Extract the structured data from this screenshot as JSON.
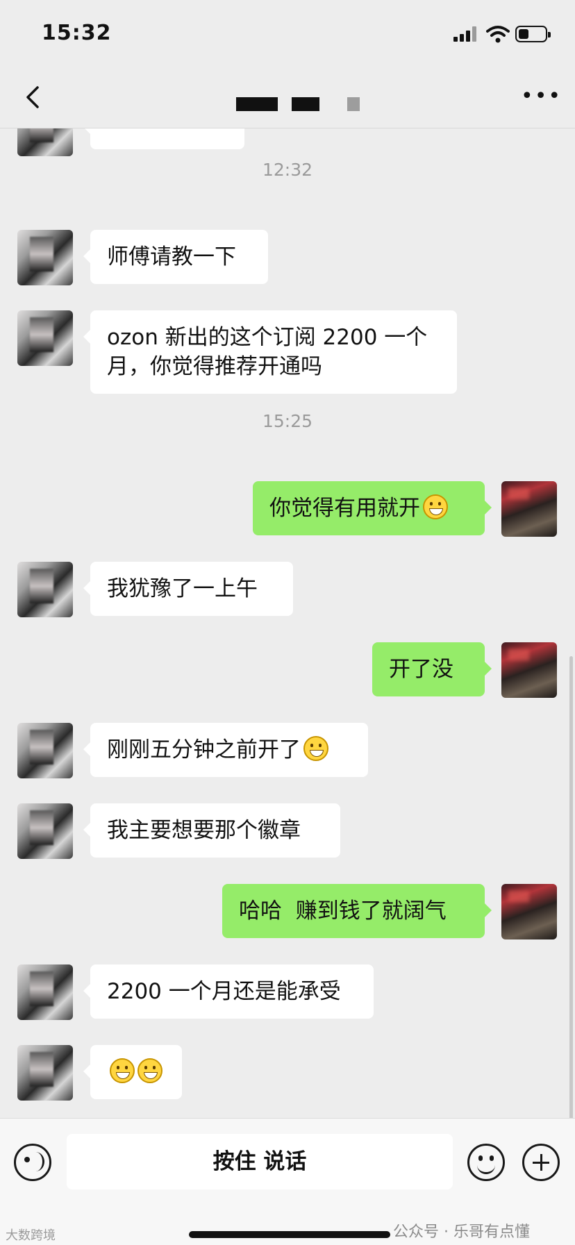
{
  "status_bar": {
    "time": "15:32"
  },
  "nav": {
    "title": ""
  },
  "messages": [
    {
      "type": "time",
      "text": "12:32"
    },
    {
      "type": "msg",
      "side": "left",
      "text": "师傅请教一下"
    },
    {
      "type": "msg",
      "side": "left",
      "text": "ozon 新出的这个订阅 2200 一个\n月，你觉得推荐开通吗"
    },
    {
      "type": "time",
      "text": "15:25"
    },
    {
      "type": "msg",
      "side": "right",
      "text": "你觉得有用就开",
      "emoji": "grin-emoji"
    },
    {
      "type": "msg",
      "side": "left",
      "text": "我犹豫了一上午"
    },
    {
      "type": "msg",
      "side": "right",
      "text": "开了没"
    },
    {
      "type": "msg",
      "side": "left",
      "text": "刚刚五分钟之前开了",
      "emoji": "tears-of-joy-emoji"
    },
    {
      "type": "msg",
      "side": "left",
      "text": "我主要想要那个徽章"
    },
    {
      "type": "msg",
      "side": "right",
      "text": "哈哈  赚到钱了就阔气"
    },
    {
      "type": "msg",
      "side": "left",
      "text": "2200 一个月还是能承受"
    },
    {
      "type": "msg",
      "side": "left",
      "text": "",
      "emoji": "grin-emoji-x2"
    }
  ],
  "input_bar": {
    "hold_to_talk": "按住 说话"
  },
  "watermarks": {
    "left": "大数跨境",
    "right": "公众号 · 乐哥有点懂"
  }
}
